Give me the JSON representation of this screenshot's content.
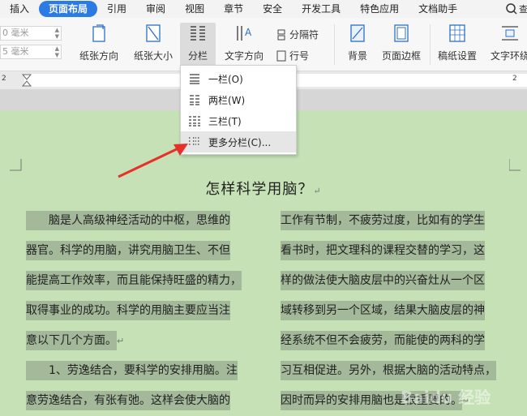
{
  "tabs": [
    {
      "label": "插入",
      "active": false
    },
    {
      "label": "页面布局",
      "active": true
    },
    {
      "label": "引用",
      "active": false
    },
    {
      "label": "审阅",
      "active": false
    },
    {
      "label": "视图",
      "active": false
    },
    {
      "label": "章节",
      "active": false
    },
    {
      "label": "安全",
      "active": false
    },
    {
      "label": "开发工具",
      "active": false
    },
    {
      "label": "特色应用",
      "active": false
    },
    {
      "label": "文档助手",
      "active": false
    }
  ],
  "search_glyph": "查",
  "ribbon": {
    "margin_top": "0 毫米",
    "margin_bottom": "5 毫米",
    "paper_direction": "纸张方向",
    "paper_size": "纸张大小",
    "columns": "分栏",
    "text_direction": "文字方向",
    "separator": "分隔符",
    "line_number": "行号",
    "background": "背景",
    "page_border": "页面边框",
    "manuscript": "稿纸设置",
    "text_wrap": "文字环绕"
  },
  "ruler": {
    "left_num": "2",
    "right_num": "2"
  },
  "dropdown": {
    "items": [
      {
        "label": "一栏(O)"
      },
      {
        "label": "两栏(W)"
      },
      {
        "label": "三栏(T)"
      },
      {
        "label": "更多分栏(C)..."
      }
    ]
  },
  "document": {
    "title": "怎样科学用脑？",
    "left_column": [
      "　　脑是人高级神经活动的中枢，思维的",
      "器官。科学的用脑，讲究用脑卫生、不但",
      "能提高工作效率，而且能保持旺盛的精力，",
      "取得事业的成功。科学的用脑主要应当注",
      "意以下几个方面。",
      "　　1、劳逸结合，要科学的安排用脑。注",
      "意劳逸结合，有张有弛。这样会使大脑的"
    ],
    "right_column": [
      "工作有节制，不疲劳过度，比如有的学生",
      "看书时，把文理科的课程交替的学习，这",
      "样的做法使大脑皮层中的兴奋灶从一个区",
      "域转移到另一个区域，结果大脑皮层的神",
      "经系统不但不会疲劳，而能使的两科的学",
      "习互相促进。另外，根据大脑的活动特点，",
      "因时而异的安排用脑也是很重要的。"
    ]
  },
  "watermark": "Baidu 经验",
  "colors": {
    "accent": "#2c7be5",
    "page": "#c5e1b5",
    "highlight": "#a3b99a",
    "arrow": "#e8302a"
  }
}
